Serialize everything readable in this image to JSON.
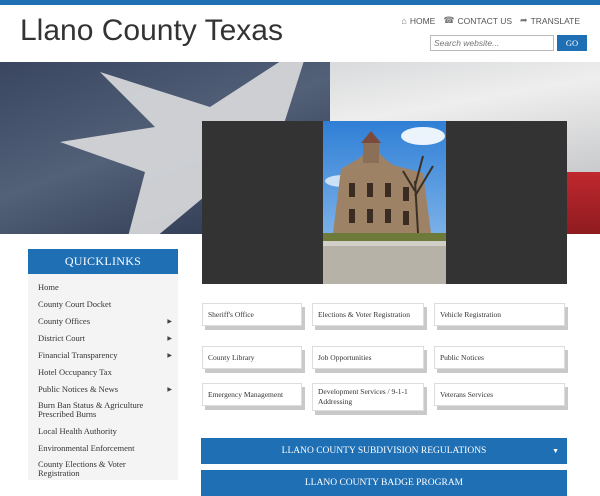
{
  "site": {
    "title": "Llano County Texas"
  },
  "topnav": [
    {
      "icon": "home-icon",
      "glyph": "⌂",
      "label": "HOME"
    },
    {
      "icon": "phone-icon",
      "glyph": "☎",
      "label": "CONTACT US"
    },
    {
      "icon": "share-icon",
      "glyph": "➦",
      "label": "TRANSLATE"
    }
  ],
  "search": {
    "placeholder": "Search website...",
    "button": "GO"
  },
  "quicklinks": {
    "header": "QUICKLINKS",
    "items": [
      {
        "label": "Home",
        "has_submenu": false
      },
      {
        "label": "County Court Docket",
        "has_submenu": false
      },
      {
        "label": "County Offices",
        "has_submenu": true
      },
      {
        "label": "District Court",
        "has_submenu": true
      },
      {
        "label": "Financial Transparency",
        "has_submenu": true
      },
      {
        "label": "Hotel Occupancy Tax",
        "has_submenu": false
      },
      {
        "label": "Public Notices & News",
        "has_submenu": true
      },
      {
        "label": "Burn Ban Status & Agriculture Prescribed Burns",
        "has_submenu": false
      },
      {
        "label": "Local Health Authority",
        "has_submenu": false
      },
      {
        "label": "Environmental Enforcement",
        "has_submenu": false
      },
      {
        "label": "County Elections & Voter Registration",
        "has_submenu": false
      }
    ]
  },
  "buttons": [
    "Sheriff's Office",
    "Elections & Voter Registration",
    "Vehicle Registration",
    "County Library",
    "Job Opportunities",
    "Public Notices",
    "Emergency Management",
    "Development Services / 9-1-1 Addressing",
    "Veterans Services"
  ],
  "bars": [
    {
      "label": "LLANO COUNTY SUBDIVISION REGULATIONS",
      "arrow": "▼"
    },
    {
      "label": "LLANO COUNTY BADGE PROGRAM",
      "arrow": ""
    }
  ],
  "colors": {
    "accent": "#1f6fb5"
  }
}
